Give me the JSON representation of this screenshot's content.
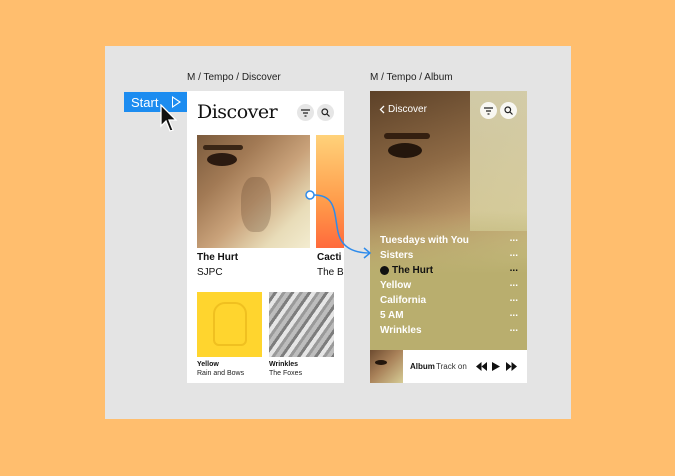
{
  "frames": {
    "discover_label": "M / Tempo / Discover",
    "album_label": "M / Tempo / Album"
  },
  "start_button": {
    "label": "Start"
  },
  "discover": {
    "title": "Discover",
    "featured": [
      {
        "title": "The Hurt",
        "artist": "SJPC"
      },
      {
        "title": "Cacti",
        "artist": "The B"
      }
    ],
    "albums": [
      {
        "title": "Yellow",
        "artist": "Rain and Bows"
      },
      {
        "title": "Wrinkles",
        "artist": "The Foxes"
      }
    ]
  },
  "album": {
    "back_label": "Discover",
    "tracks": [
      {
        "title": "Tuesdays with You",
        "more": "..."
      },
      {
        "title": "Sisters",
        "more": "..."
      },
      {
        "title": "The Hurt",
        "more": "...",
        "playing": true
      },
      {
        "title": "Yellow",
        "more": "..."
      },
      {
        "title": "California",
        "more": "..."
      },
      {
        "title": "5 AM",
        "more": "..."
      },
      {
        "title": "Wrinkles",
        "more": "..."
      }
    ],
    "player": {
      "album_label": "Album",
      "track_label": "Track on"
    }
  },
  "colors": {
    "page_background": "#FFBE6E",
    "canvas": "#E4E4E4",
    "accent_blue": "#1C8CF0",
    "album_tint": "#B9AE6E"
  },
  "icons": [
    "play-icon",
    "cursor-icon",
    "filter-icon",
    "search-icon",
    "chevron-left-icon",
    "more-icon",
    "skip-back-icon",
    "skip-forward-icon",
    "connector-arrow-icon"
  ]
}
